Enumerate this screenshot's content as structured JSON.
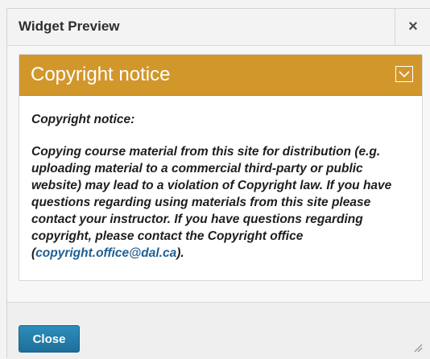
{
  "dialog": {
    "title": "Widget Preview",
    "close_symbol": "×",
    "close_icon": "close-icon"
  },
  "widget": {
    "title": "Copyright notice",
    "collapse_icon": "chevron-down-icon",
    "header_color": "#d2972b",
    "body_heading": "Copyright notice:",
    "body_text": "Copying course material from this site for distribution (e.g. uploading material to a commercial third-party or public website) may lead to a violation of Copyright law. If you have questions regarding using materials from this site please contact your instructor. If you have questions regarding copyright, please contact the Copyright office (",
    "email": "copyright.office@dal.ca",
    "body_end": ").",
    "link_color": "#1f5f93"
  },
  "footer": {
    "close_label": "Close",
    "button_color": "#1e6f99",
    "resize_icon": "resize-grip-icon"
  }
}
